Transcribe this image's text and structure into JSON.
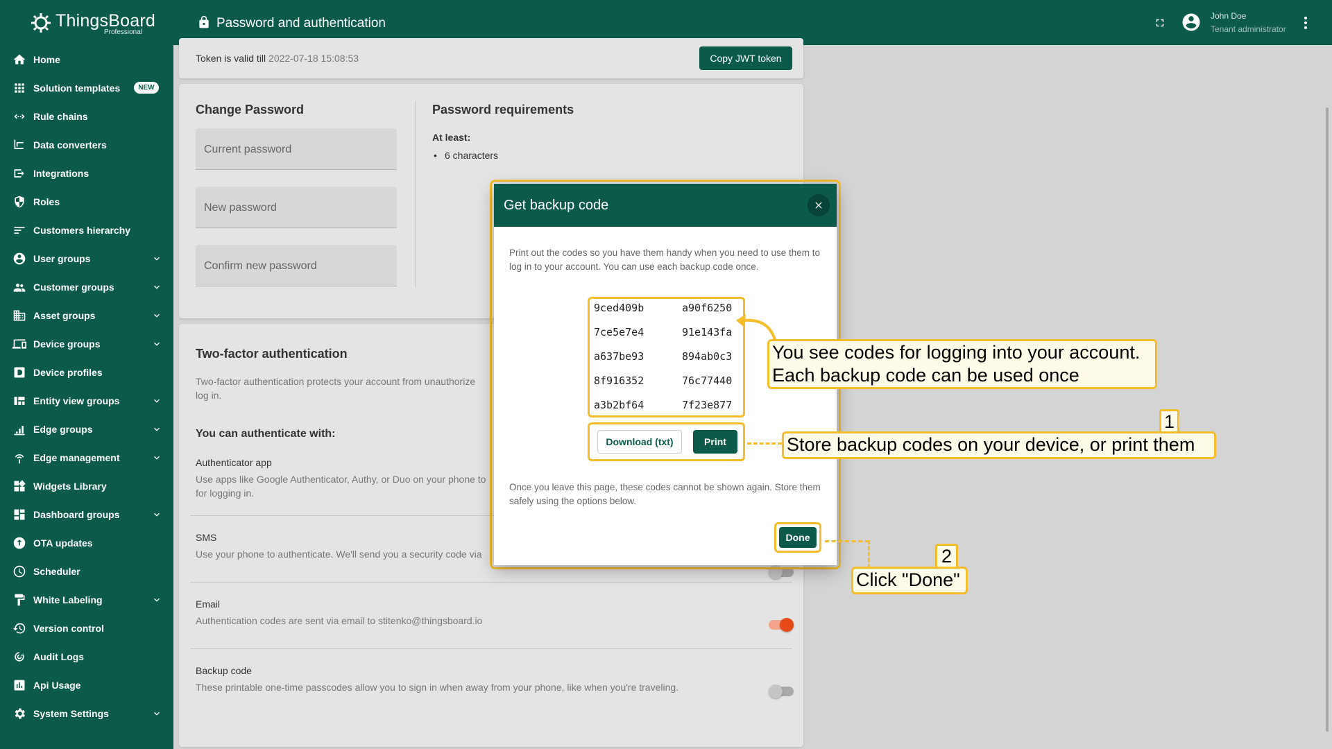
{
  "app": {
    "name": "ThingsBoard",
    "edition": "Professional"
  },
  "topbar": {
    "title": "Password and authentication",
    "user_name": "John Doe",
    "user_role": "Tenant administrator"
  },
  "sidebar": {
    "items": [
      {
        "label": "Home",
        "icon": "home-icon",
        "chevron": false
      },
      {
        "label": "Solution templates",
        "icon": "grid-icon",
        "badge": "NEW",
        "chevron": false
      },
      {
        "label": "Rule chains",
        "icon": "rule-chain-icon",
        "chevron": false
      },
      {
        "label": "Data converters",
        "icon": "converter-icon",
        "chevron": false
      },
      {
        "label": "Integrations",
        "icon": "integration-icon",
        "chevron": false
      },
      {
        "label": "Roles",
        "icon": "shield-icon",
        "chevron": false
      },
      {
        "label": "Customers hierarchy",
        "icon": "hierarchy-icon",
        "chevron": false
      },
      {
        "label": "User groups",
        "icon": "account-circle-icon",
        "chevron": true
      },
      {
        "label": "Customer groups",
        "icon": "people-icon",
        "chevron": true
      },
      {
        "label": "Asset groups",
        "icon": "building-icon",
        "chevron": true
      },
      {
        "label": "Device groups",
        "icon": "devices-icon",
        "chevron": true
      },
      {
        "label": "Device profiles",
        "icon": "device-profile-icon",
        "chevron": false
      },
      {
        "label": "Entity view groups",
        "icon": "view-quilt-icon",
        "chevron": true
      },
      {
        "label": "Edge groups",
        "icon": "edge-icon",
        "chevron": true
      },
      {
        "label": "Edge management",
        "icon": "router-icon",
        "chevron": true
      },
      {
        "label": "Widgets Library",
        "icon": "widgets-icon",
        "chevron": false
      },
      {
        "label": "Dashboard groups",
        "icon": "dashboard-icon",
        "chevron": true
      },
      {
        "label": "OTA updates",
        "icon": "ota-icon",
        "chevron": false
      },
      {
        "label": "Scheduler",
        "icon": "clock-icon",
        "chevron": false
      },
      {
        "label": "White Labeling",
        "icon": "format-paint-icon",
        "chevron": true
      },
      {
        "label": "Version control",
        "icon": "history-icon",
        "chevron": false
      },
      {
        "label": "Audit Logs",
        "icon": "track-changes-icon",
        "chevron": false
      },
      {
        "label": "Api Usage",
        "icon": "insert-chart-icon",
        "chevron": false
      },
      {
        "label": "System Settings",
        "icon": "settings-icon",
        "chevron": true
      }
    ]
  },
  "token": {
    "label": "Token is valid till",
    "value": "2022-07-18 15:08:53",
    "copy_button": "Copy JWT token"
  },
  "change_password": {
    "title": "Change Password",
    "current_placeholder": "Current password",
    "new_placeholder": "New password",
    "confirm_placeholder": "Confirm new password",
    "requirements_title": "Password requirements",
    "at_least": "At least:",
    "requirement": "6 characters"
  },
  "two_factor": {
    "title": "Two-factor authentication",
    "description": "Two-factor authentication protects your account from unauthorize",
    "description_cont": "log in.",
    "subtitle": "You can authenticate with:",
    "methods": [
      {
        "title": "Authenticator app",
        "desc": "Use apps like Google Authenticator, Authy, or Duo on your phone to",
        "desc2": "for logging in."
      },
      {
        "title": "SMS",
        "desc": "Use your phone to authenticate. We'll send you a security code via",
        "desc2": ""
      },
      {
        "title": "Email",
        "desc": "Authentication codes are sent via email to stitenko@thingsboard.io",
        "desc2": "",
        "enabled": true
      },
      {
        "title": "Backup code",
        "desc": "These printable one-time passcodes allow you to sign in when away from your phone, like when you're traveling.",
        "desc2": "",
        "enabled": false
      }
    ]
  },
  "dialog": {
    "title": "Get backup code",
    "intro": "Print out the codes so you have them handy when you need to use them to log in to your account. You can use each backup code once.",
    "codes": [
      "9ced409b",
      "a90f6250",
      "7ce5e7e4",
      "91e143fa",
      "a637be93",
      "894ab0c3",
      "8f916352",
      "76c77440",
      "a3b2bf64",
      "7f23e877"
    ],
    "download_button": "Download (txt)",
    "print_button": "Print",
    "outro": "Once you leave this page, these codes cannot be shown again. Store them safely using the options below.",
    "done_button": "Done"
  },
  "annotations": {
    "codes_line1": "You see codes for logging into your account.",
    "codes_line2": "Each backup code can be used once",
    "step1_number": "1",
    "step1_text": "Store backup codes on your device, or print them",
    "step2_number": "2",
    "step2_text": "Click \"Done\""
  },
  "colors": {
    "primary": "#0b5a4a",
    "accent": "#f6bd2b",
    "toggle_on": "#e64a19"
  }
}
